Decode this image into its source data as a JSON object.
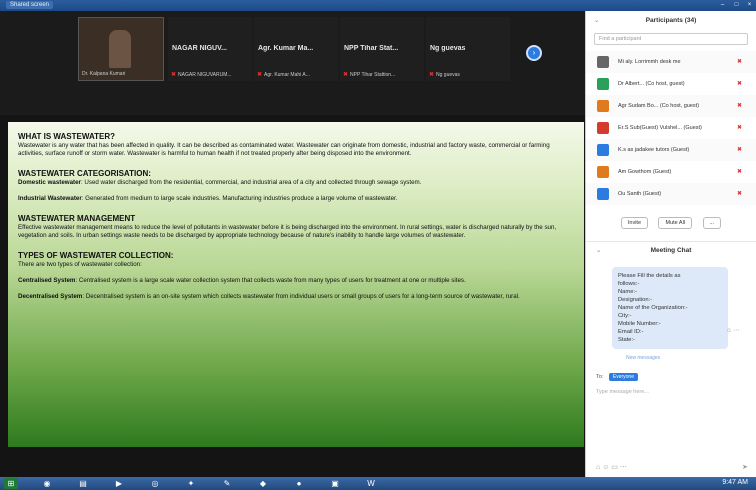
{
  "window": {
    "title_tab": "Shared screen"
  },
  "video_strip": {
    "self_name": "Dr. Kalpana Kumari",
    "tiles": [
      {
        "big": "NAGAR NIGUV...",
        "small": "NAGAR NIGUVARUM..."
      },
      {
        "big": "Agr. Kumar Ma...",
        "small": "Agr. Kumar Mahi A..."
      },
      {
        "big": "NPP Tihar Stat...",
        "small": "NPP Tihar Stattion..."
      },
      {
        "big": "Ng guevas",
        "small": "Ng guevas"
      }
    ]
  },
  "slide": {
    "h1": "WHAT IS WASTEWATER?",
    "p1": "Wastewater is any water that has been affected in quality. It can be described as contaminated water. Wastewater can originate from domestic, industrial and factory waste, commercial or farming activities, surface runoff or storm water. Wastewater is harmful to human health if not treated properly after being disposed into the environment.",
    "h2": "WASTEWATER CATEGORISATION:",
    "p2_label": "Domestic wastewater",
    "p2": ": Used water discharged from the residential, commercial, and industrial area of a city and collected through sewage system.",
    "p3_label": "Industrial Wastewater",
    "p3": ": Generated from medium to large scale industries. Manufacturing industries produce a large volume of wastewater.",
    "h3": "WASTEWATER MANAGEMENT",
    "p4": "Effective wastewater management means to reduce the level of pollutants in wastewater before it is being discharged into the environment. In rural settings, water is discharged naturally by the sun, vegetation and soils. In urban settings waste needs to be discharged by appropriate technology because of nature's inability to handle large volumes of wastewater.",
    "h4": "TYPES OF WASTEWATER COLLECTION:",
    "p5": "There are two types of wastewater collection:",
    "p6_label": "Centralised System",
    "p6": ": Centralised system is a large scale water collection system that collects waste from many types of users for treatment at one or multiple sites.",
    "p7_label": "Decentralised System",
    "p7": ": Decentralised system is an on-site system which collects wastewater from individual users or small groups of users for a long-term source of wastewater, rural."
  },
  "participants": {
    "header": "Participants (34)",
    "find_placeholder": "Find a participant",
    "items": [
      {
        "name": "Mi aly. Lorrimmh desk me",
        "color": "#666"
      },
      {
        "name": "Dr Albert... (Co host, guest)",
        "color": "#2aa05a"
      },
      {
        "name": "Agr Sudam Bo... (Co host, guest)",
        "color": "#e07a1f"
      },
      {
        "name": "Er.S Sub(Guest) Vulshel... (Guest)",
        "color": "#d43b2f"
      },
      {
        "name": "K.s as jadakee tutors (Guest)",
        "color": "#2b7be0"
      },
      {
        "name": "Am Gowthom (Guest)",
        "color": "#e07a1f"
      },
      {
        "name": "Ou Santh (Guest)",
        "color": "#2b7be0"
      }
    ],
    "invite": "Invite",
    "mute_all": "Mute All",
    "more": "..."
  },
  "chat": {
    "header": "Meeting Chat",
    "lines": [
      "Please Fill the details as",
      "follows:-",
      "Name:-",
      "Designation:-",
      "Name of the Organization:-",
      "City:-",
      "Mobile Number:-",
      "Email ID:-",
      "State:-"
    ],
    "new_messages": "New messages",
    "to_label": "To:",
    "to_value": "Everyone",
    "input_placeholder": "Type message here..."
  },
  "taskbar": {
    "clock": "9:47 AM"
  }
}
